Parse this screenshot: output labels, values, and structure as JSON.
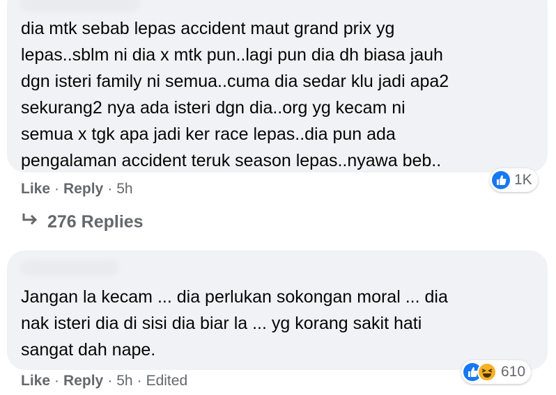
{
  "comments": [
    {
      "text": "dia mtk sebab lepas accident maut grand prix yg\nlepas..sblm ni dia x mtk pun..lagi pun dia dh biasa jauh\ndgn isteri family ni semua..cuma dia sedar klu jadi apa2\nsekurang2 nya ada isteri dgn dia..org yg kecam ni\nsemua x tgk apa jadi ker race lepas..dia pun ada\npengalaman accident teruk season lepas..nyawa beb..",
      "reaction_count": "1K",
      "like_label": "Like",
      "reply_label": "Reply",
      "time": "5h",
      "replies_label": "276 Replies"
    },
    {
      "text": "Jangan la kecam ... dia perlukan sokongan moral ... dia\nnak isteri dia di sisi dia biar la ... yg korang sakit hati\nsangat dah nape.",
      "reaction_count": "610",
      "like_label": "Like",
      "reply_label": "Reply",
      "time": "5h",
      "edited_label": "Edited"
    }
  ],
  "icons": {
    "like": "like-icon",
    "haha": "haha-icon",
    "reply_arrow": "reply-arrow-icon"
  },
  "colors": {
    "bubble": "#f0f2f5",
    "like_blue": "#1877f2",
    "haha_yellow": "#f7b125",
    "meta_gray": "#65676b"
  }
}
